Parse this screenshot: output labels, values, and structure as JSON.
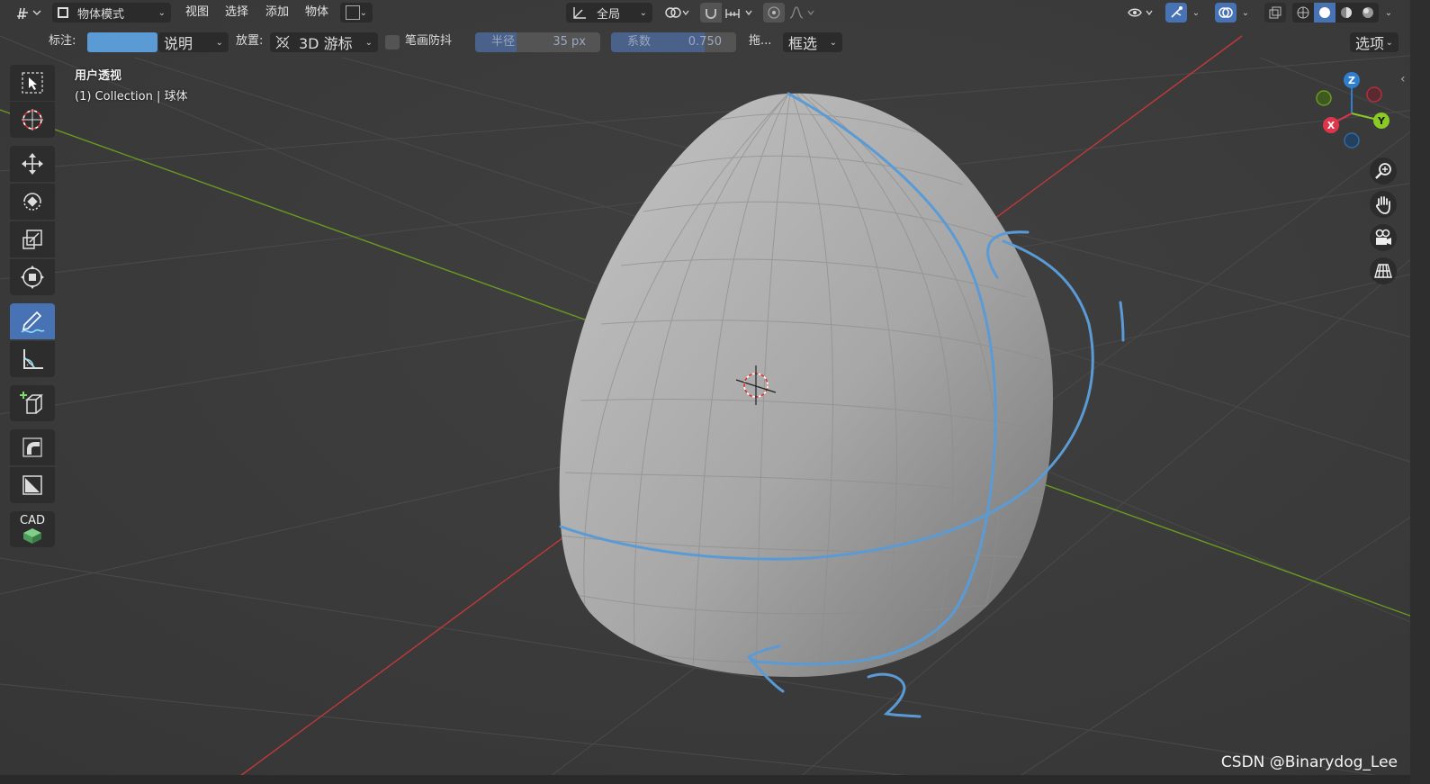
{
  "header": {
    "mode_label": "物体模式",
    "menus": [
      "视图",
      "选择",
      "添加",
      "物体"
    ],
    "orientation_label": "全局"
  },
  "toolbar": {
    "annotation_label": "标注:",
    "annotation_layer": "说明",
    "placement_label": "放置:",
    "placement_value": "3D 游标",
    "stabilize_label": "笔画防抖",
    "radius_label": "半径",
    "radius_value": "35 px",
    "factor_label": "系数",
    "factor_value": "0.750",
    "drag_label": "拖...",
    "drag_value": "框选",
    "options_label": "选项"
  },
  "viewport": {
    "view_name": "用户透视",
    "collection_info": "(1) Collection | 球体"
  },
  "gizmo": {
    "z": "Z",
    "y": "Y",
    "x": "X"
  },
  "toolshelf": {
    "cad_label": "CAD"
  },
  "annotations": {
    "number_1": "1",
    "number_2": "2"
  },
  "watermark": "CSDN @Binarydog_Lee",
  "colors": {
    "annotation": "#5b9bd5",
    "accent": "#4772b3",
    "x_axis": "#c0393b",
    "y_axis": "#6a9a1f",
    "gizmo_z": "#2f7fd0",
    "gizmo_y": "#8ac926",
    "gizmo_x": "#e0344b"
  },
  "icons": [
    "editor-type-icon",
    "object-mode-icon",
    "orientation-icon",
    "link-icon",
    "snap-magnet-icon",
    "snap-increment-icon",
    "proportional-edit-icon",
    "falloff-icon",
    "visibility-icon",
    "gizmo-icon",
    "overlay-icon",
    "xray-icon",
    "shading-wireframe-icon",
    "shading-solid-icon",
    "shading-material-icon",
    "shading-rendered-icon",
    "select-box-icon",
    "cursor-icon",
    "move-icon",
    "rotate-icon",
    "scale-icon",
    "transform-icon",
    "annotate-icon",
    "measure-icon",
    "add-cube-icon",
    "spin-icon",
    "shear-icon",
    "cad-icon",
    "zoom-icon",
    "pan-hand-icon",
    "camera-icon",
    "perspective-grid-icon"
  ]
}
